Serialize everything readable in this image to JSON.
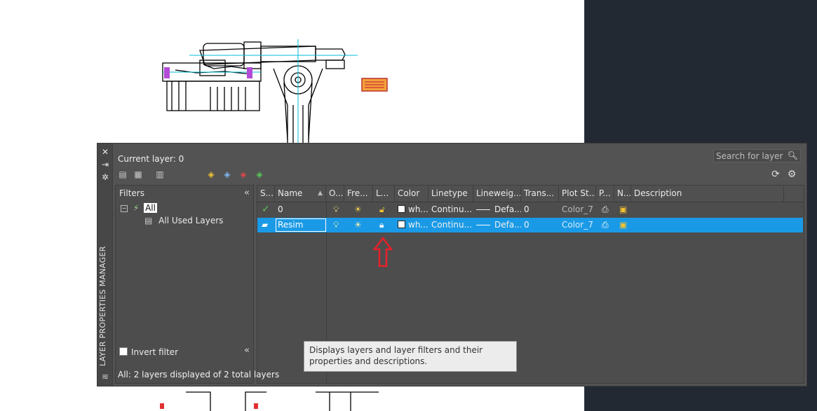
{
  "palette": {
    "title": "LAYER PROPERTIES MANAGER",
    "current_layer_label": "Current layer: 0",
    "search_placeholder": "Search for layer",
    "filters_header": "Filters",
    "tree": {
      "root": "All",
      "child": "All Used Layers"
    },
    "invert_filter_label": "Invert filter",
    "status": "All: 2 layers displayed of 2 total layers"
  },
  "columns": [
    "S...",
    "Name",
    "O...",
    "Fre...",
    "L...",
    "Color",
    "Linetype",
    "Lineweig...",
    "Trans...",
    "Plot St...",
    "P...",
    "N...",
    "Description"
  ],
  "layers": [
    {
      "status": "current",
      "name": "0",
      "on": true,
      "freeze": "thawed",
      "lock": "unlocked",
      "color": "wh...",
      "linetype": "Continu...",
      "lineweight": "Defa...",
      "transparency": "0",
      "plot_style": "Color_7",
      "selected": false
    },
    {
      "status": "layer",
      "name": "Resim",
      "on": true,
      "freeze": "thawed",
      "lock": "locked",
      "color": "wh...",
      "linetype": "Continu...",
      "lineweight": "Defa...",
      "transparency": "0",
      "plot_style": "Color_7",
      "selected": true
    }
  ],
  "tooltip": "Displays layers and layer filters and their properties and descriptions.",
  "colors": {
    "selection": "#1a9ae6",
    "annotation_arrow": "#e8202a",
    "background": "#232933"
  }
}
